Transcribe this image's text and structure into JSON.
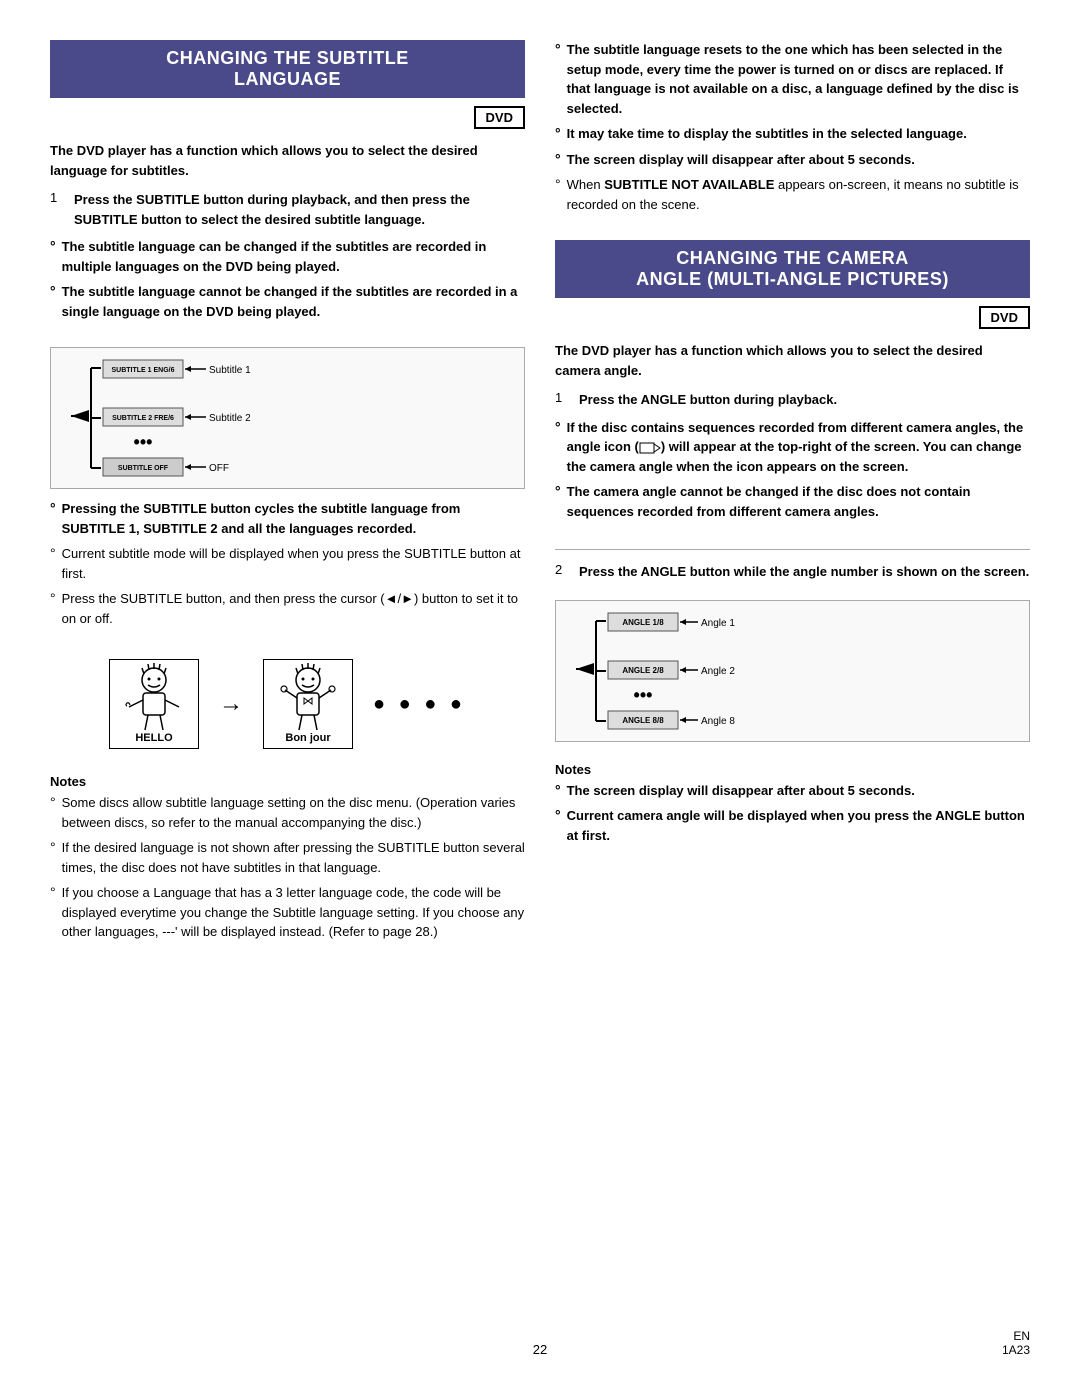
{
  "left_section": {
    "title_line1": "CHANGING THE SUBTITLE",
    "title_line2": "LANGUAGE",
    "dvd_label": "DVD",
    "intro": "The DVD player has a function which allows you to select the desired language for subtitles.",
    "step1": {
      "num": "1",
      "text": "Press the SUBTITLE button during playback, and then press the SUBTITLE button to select the desired subtitle language."
    },
    "bullets": [
      {
        "text": "The subtitle language can be changed if the subtitles are recorded in multiple languages on the DVD being played.",
        "bold": true
      },
      {
        "text": "The subtitle language cannot be changed if the subtitles are recorded in a single language on the DVD being played.",
        "bold": true
      }
    ],
    "diagram": {
      "screens": [
        {
          "label": "SUBTITLE 1 ENG/6"
        },
        {
          "label": "SUBTITLE 2 FRE/6"
        },
        {
          "label": "SUBTITLE OFF",
          "off": true
        }
      ],
      "labels": [
        "Subtitle 1",
        "Subtitle 2",
        "OFF"
      ]
    },
    "bullets2": [
      {
        "text": "Pressing the SUBTITLE button cycles the subtitle language from SUBTITLE 1, SUBTITLE 2 and all the languages recorded.",
        "bold": true
      },
      {
        "text": "Current subtitle mode will be displayed when you press the SUBTITLE button at first.",
        "bold": false
      },
      {
        "text": "Press the SUBTITLE button, and then press the cursor (◄/►) button to set it to on or off.",
        "bold": false
      }
    ],
    "characters": {
      "char1_label": "HELLO",
      "char2_label": "Bon jour"
    },
    "notes_title": "Notes",
    "notes": [
      {
        "text": "Some discs allow subtitle language setting on the disc menu. (Operation varies between discs, so refer to the manual accompanying the disc.)"
      },
      {
        "text": "If the desired language is not shown after pressing the SUBTITLE button several times, the disc does not have subtitles in that language."
      },
      {
        "text": "If you choose a Language that has a 3 letter language code, the code will be displayed everytime you change the Subtitle language setting. If you choose any other languages, ---' will be displayed instead. (Refer to page 28.)"
      }
    ]
  },
  "right_section": {
    "bullets_top": [
      {
        "text": "The subtitle language resets to the one which has been selected in the setup mode, every time the power is turned on or discs are replaced. If that language is not available on a disc, a language defined by the disc is selected.",
        "bold": true
      },
      {
        "text": "It may take time to display the subtitles in the selected language.",
        "bold": true
      },
      {
        "text": "The screen display will disappear after about 5 seconds.",
        "bold": true
      },
      {
        "text": "When SUBTITLE NOT AVAILABLE appears on-screen, it means no subtitle is recorded on the scene.",
        "bold": true,
        "bold_phrase": "SUBTITLE NOT AVAILABLE"
      }
    ],
    "camera_section": {
      "title_line1": "CHANGING THE CAMERA",
      "title_line2": "ANGLE (Multi-Angle Pictures)",
      "dvd_label": "DVD",
      "intro": "The DVD player has a function which allows you to select the desired camera angle.",
      "step1": {
        "num": "1",
        "text": "Press the ANGLE button during playback."
      },
      "bullets": [
        {
          "text": "If the disc contains sequences recorded from different camera angles, the angle icon (  ) will appear at the top-right of the screen. You can change the camera angle when the icon appears on the screen.",
          "bold": true
        },
        {
          "text": "The camera angle cannot be changed if the disc does not contain sequences recorded from different camera angles.",
          "bold": true
        }
      ],
      "step2": {
        "num": "2",
        "text": "Press the ANGLE button while the angle number is shown on the screen."
      },
      "diagram": {
        "screens": [
          {
            "label": "ANGLE 1/8"
          },
          {
            "label": "ANGLE 2/8"
          },
          {
            "label": "ANGLE 8/8"
          }
        ],
        "labels": [
          "Angle 1",
          "Angle 2",
          "Angle 8"
        ]
      },
      "notes_title": "Notes",
      "notes": [
        {
          "text": "The screen display will disappear after about 5 seconds.",
          "bold": true
        },
        {
          "text": "Current camera angle will be displayed when you press the ANGLE button at first.",
          "bold": true
        }
      ]
    }
  },
  "footer": {
    "page_num": "22",
    "code_line1": "EN",
    "code_line2": "1A23"
  }
}
